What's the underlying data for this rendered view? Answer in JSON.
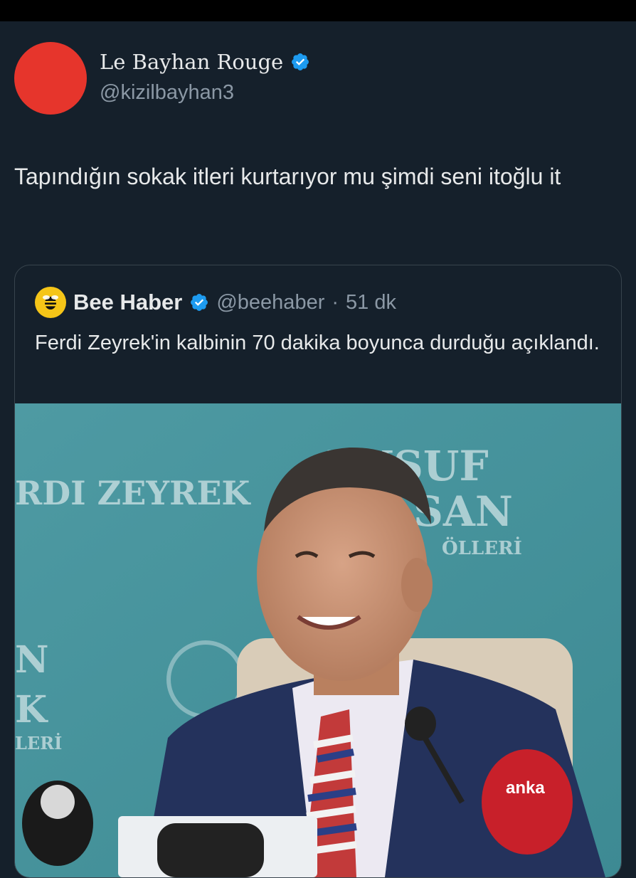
{
  "author": {
    "display_name": "Le Bayhan Rouge",
    "handle": "@kizilbayhan3",
    "avatar_color": "#e6352c",
    "verified_icon": "verified-badge-icon"
  },
  "tweet": {
    "text": "Tapındığın sokak itleri kurtarıyor mu şimdi seni itoğlu it"
  },
  "quote": {
    "display_name": "Bee Haber",
    "handle": "@beehaber",
    "separator": "·",
    "time": "51 dk",
    "text": "Ferdi Zeyrek'in kalbinin 70 dakika boyunca durduğu açıklandı.",
    "avatar_color": "#f5c518",
    "avatar_icon": "bee-logo-icon",
    "media": {
      "description_icon": "press-conference-photo",
      "backdrop_texts": [
        "RDI ZEYREK",
        "YUSUF",
        "SAN",
        "ÖLLERİ",
        "N",
        "K",
        "LERİ"
      ],
      "mic_brand": "anka"
    }
  },
  "colors": {
    "background": "#15202b",
    "text_primary": "#e7e9ea",
    "text_secondary": "#8b98a5",
    "verified": "#1d9bf0",
    "border": "#38444d"
  }
}
